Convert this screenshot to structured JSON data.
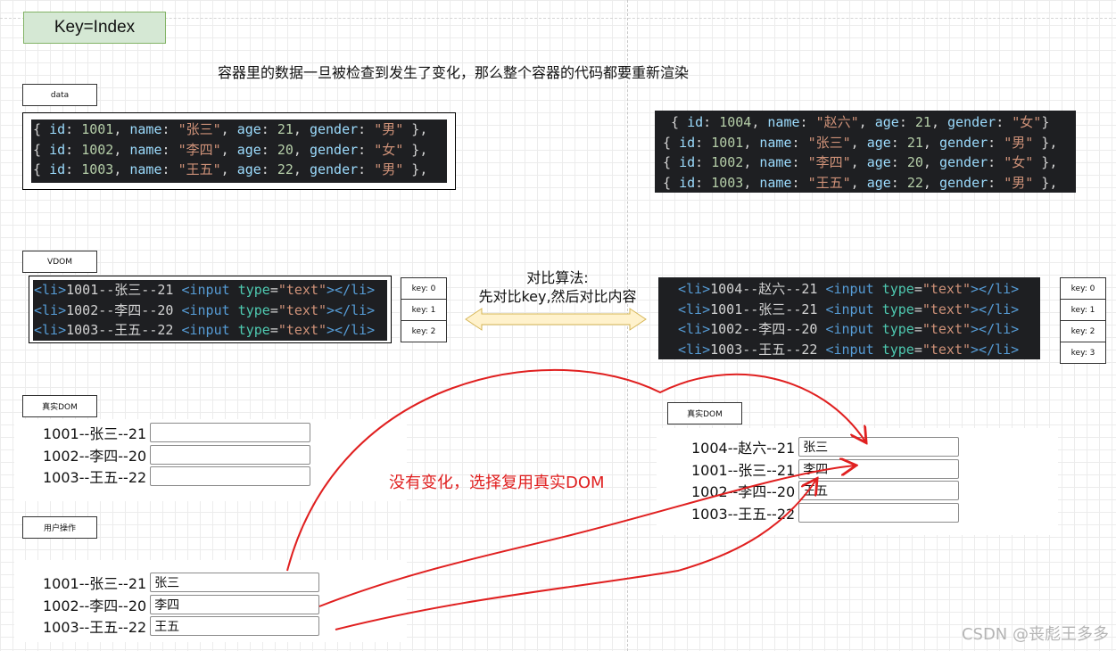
{
  "title": "Key=Index",
  "heading": "容器里的数据一旦被检查到发生了变化，那么整个容器的代码都要重新渲染",
  "labels": {
    "data": "data",
    "vdom": "VDOM",
    "real_dom_left": "真实DOM",
    "real_dom_right": "真实DOM",
    "user_op": "用户操作"
  },
  "data_before": [
    {
      "id": "1001",
      "name": "\"张三\"",
      "age": "21",
      "gender": "\"男\""
    },
    {
      "id": "1002",
      "name": "\"李四\"",
      "age": "20",
      "gender": "\"女\""
    },
    {
      "id": "1003",
      "name": "\"王五\"",
      "age": "22",
      "gender": "\"男\""
    }
  ],
  "data_after": [
    {
      "id": "1004",
      "name": "\"赵六\"",
      "age": "21",
      "gender": "\"女\""
    },
    {
      "id": "1001",
      "name": "\"张三\"",
      "age": "21",
      "gender": "\"男\""
    },
    {
      "id": "1002",
      "name": "\"李四\"",
      "age": "20",
      "gender": "\"女\""
    },
    {
      "id": "1003",
      "name": "\"王五\"",
      "age": "22",
      "gender": "\"男\""
    }
  ],
  "vdom_before": [
    "1001--张三--21",
    "1002--李四--20",
    "1003--王五--22"
  ],
  "vdom_after": [
    "1004--赵六--21",
    "1001--张三--21",
    "1002--李四--20",
    "1003--王五--22"
  ],
  "keys_before": [
    "key: 0",
    "key: 1",
    "key: 2"
  ],
  "keys_after": [
    "key: 0",
    "key: 1",
    "key: 2",
    "key: 3"
  ],
  "compare": {
    "line1": "对比算法:",
    "line2": "先对比key,然后对比内容"
  },
  "real_dom_before": [
    {
      "text": "1001--张三--21",
      "value": ""
    },
    {
      "text": "1002--李四--20",
      "value": ""
    },
    {
      "text": "1003--王五--22",
      "value": ""
    }
  ],
  "real_dom_after": [
    {
      "text": "1004--赵六--21",
      "value": "张三"
    },
    {
      "text": "1001--张三--21",
      "value": "李四"
    },
    {
      "text": "1002--李四--20",
      "value": "王五"
    },
    {
      "text": "1003--王五--22",
      "value": ""
    }
  ],
  "user_op_items": [
    {
      "text": "1001--张三--21",
      "value": "张三"
    },
    {
      "text": "1002--李四--20",
      "value": "李四"
    },
    {
      "text": "1003--王五--22",
      "value": "王五"
    }
  ],
  "red_note": "没有变化，选择复用真实DOM",
  "watermark": "CSDN @丧彪王多多",
  "colors": {
    "arrow": "#e02020",
    "arrow_fill": "#fff2cc",
    "arrow_stroke": "#d6b656",
    "title_bg": "#d5e8d4"
  }
}
